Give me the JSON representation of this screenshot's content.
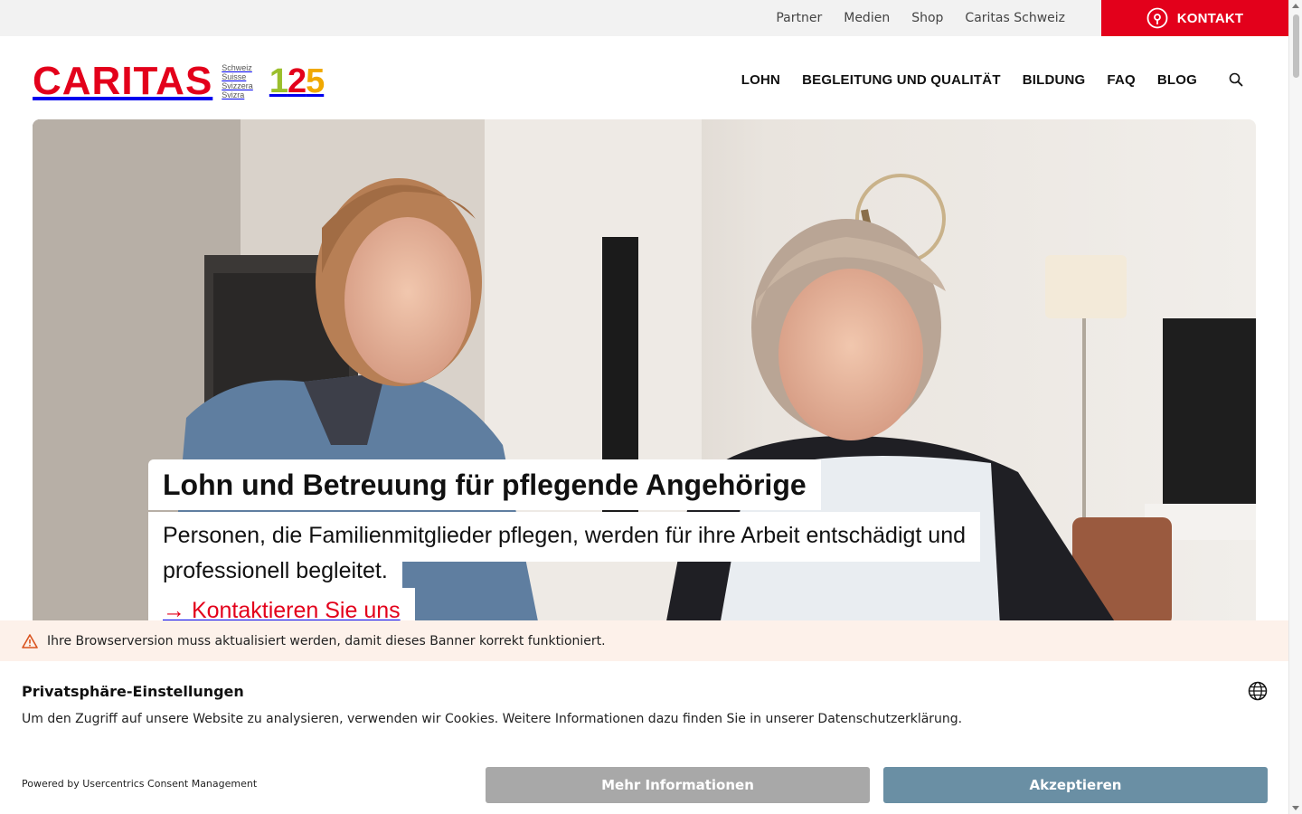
{
  "util_nav": {
    "items": [
      {
        "label": "Partner"
      },
      {
        "label": "Medien"
      },
      {
        "label": "Shop"
      },
      {
        "label": "Caritas Schweiz"
      }
    ],
    "kontakt_label": "KONTAKT",
    "kontakt_icon": "location-pin-icon"
  },
  "logo": {
    "word": "CARITAS",
    "languages": [
      "Schweiz",
      "Suisse",
      "Svizzera",
      "Svizra"
    ],
    "anniversary": [
      "1",
      "2",
      "5"
    ]
  },
  "main_nav": {
    "items": [
      {
        "label": "LOHN"
      },
      {
        "label": "BEGLEITUNG UND QUALITÄT"
      },
      {
        "label": "BILDUNG"
      },
      {
        "label": "FAQ"
      },
      {
        "label": "BLOG"
      }
    ],
    "search_icon": "search-icon"
  },
  "hero": {
    "title": "Lohn und Betreuung für pflegende Angehörige",
    "subtitle_line1": "Personen, die Familienmitglieder pflegen, werden für ihre Arbeit entschädigt und",
    "subtitle_line2": "professionell begleitet.",
    "cta": "→ Kontaktieren Sie uns"
  },
  "browser_warning": {
    "icon": "warning-icon",
    "text": "Ihre Browserversion muss aktualisiert werden, damit dieses Banner korrekt funktioniert."
  },
  "consent": {
    "title": "Privatsphäre-Einstellungen",
    "text": "Um den Zugriff auf unsere Website zu analysieren, verwenden wir Cookies. Weitere Informationen dazu finden Sie in unserer Datenschutzerklärung.",
    "powered_by": "Powered by Usercentrics Consent Management",
    "more_button": "Mehr Informationen",
    "accept_button": "Akzeptieren",
    "language_icon": "globe-icon"
  },
  "colors": {
    "brand_red": "#e3001b",
    "accept_button": "#6a8fa4",
    "more_button": "#a8a8a8",
    "warning_bg": "#fdf1ea",
    "topbar_bg": "#f2f2f2"
  }
}
